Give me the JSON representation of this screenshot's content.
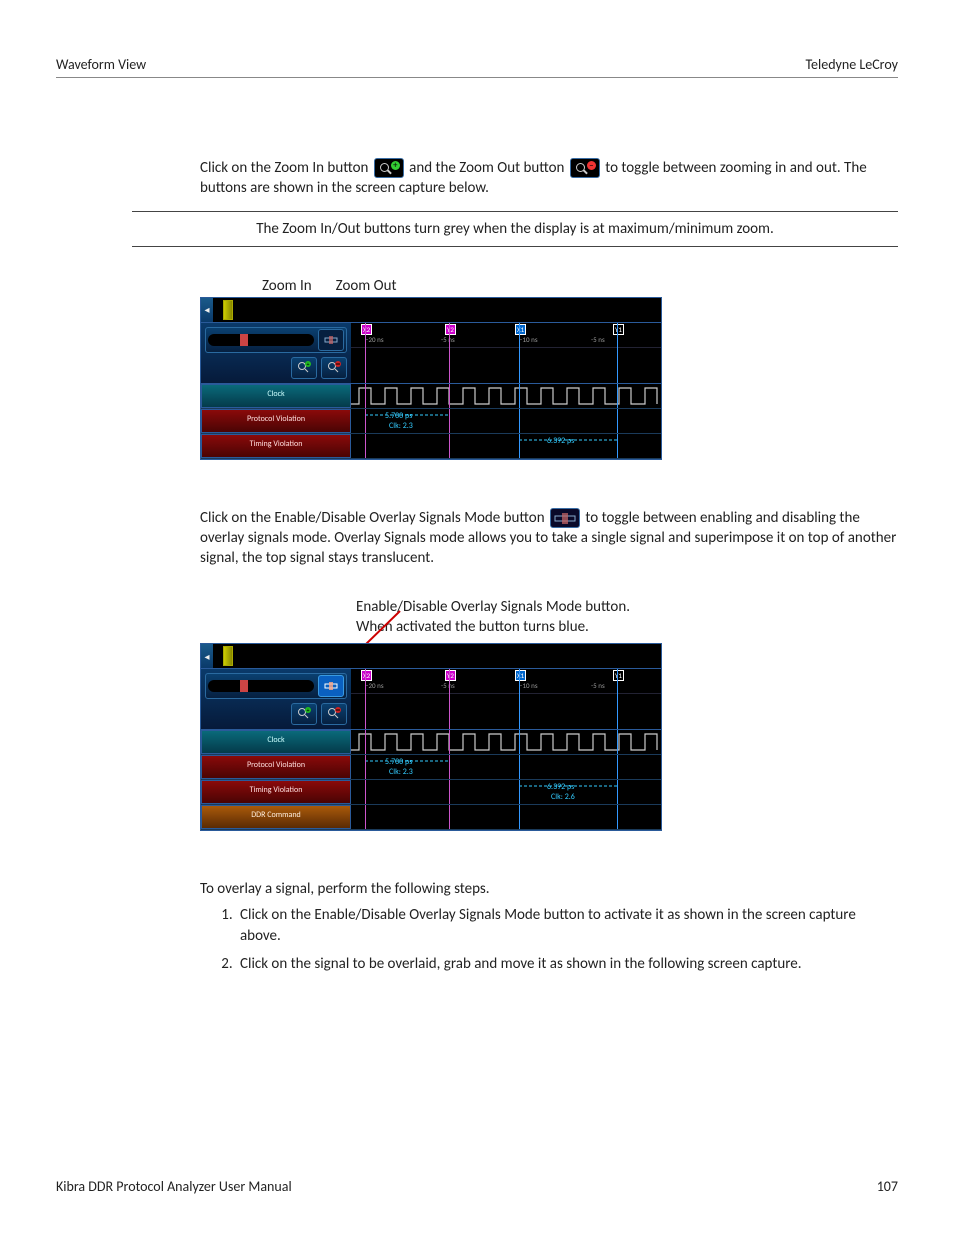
{
  "header": {
    "left": "Waveform View",
    "right": "Teledyne LeCroy"
  },
  "para1_a": "Click on the Zoom In button ",
  "para1_b": " and the Zoom Out button ",
  "para1_c": " to toggle between zooming in and out. The buttons are shown in the screen capture below.",
  "note1": "The Zoom In/Out buttons turn grey when the display is at maximum/minimum zoom.",
  "callout_zoom_in": "Zoom In",
  "callout_zoom_out": "Zoom Out",
  "shot1": {
    "markers": {
      "x2": "X2",
      "y2": "Y2",
      "x1": "X1",
      "y1": "Y1"
    },
    "ticks": {
      "t1": "−20 ns",
      "t2": "-5 ns",
      "t3": "−10 ns",
      "t4": "-5 ns"
    },
    "labels": {
      "clock": "Clock",
      "protocol": "Protocol Violation",
      "timing": "Timing Violation"
    },
    "meas": {
      "m1": "5.700 ps",
      "m1b": "Clk: 2.3",
      "m2": "6.392 ps"
    }
  },
  "para2_a": "Click on the Enable/Disable Overlay Signals Mode button ",
  "para2_b": " to toggle between enabling and disabling the overlay signals mode. Overlay Signals mode allows you to take a single signal and superimpose it on top of another signal, the top signal stays translucent.",
  "callout_overlay_l1": "Enable/Disable Overlay Signals Mode button.",
  "callout_overlay_l2": "When activated the button turns blue.",
  "shot2": {
    "markers": {
      "x2": "X2",
      "y2": "Y2",
      "x1": "X1",
      "y1": "Y1"
    },
    "ticks": {
      "t1": "−20 ns",
      "t2": "-5 ns",
      "t3": "−10 ns",
      "t4": "-5 ns"
    },
    "labels": {
      "clock": "Clock",
      "protocol": "Protocol Violation",
      "timing": "Timing Violation",
      "ddr": "DDR Command"
    },
    "meas": {
      "m1": "5.700 ps",
      "m1b": "Clk: 2.3",
      "m2": "6.392 ps",
      "m2b": "Clk: 2.6"
    }
  },
  "para3": "To overlay a signal, perform the following steps.",
  "steps": {
    "s1": "Click on the Enable/Disable Overlay Signals Mode button to activate it as shown in the screen capture above.",
    "s2": "Click on the signal to be overlaid, grab and move it as shown in the following screen capture."
  },
  "footer": {
    "left": "Kibra DDR Protocol Analyzer User Manual",
    "right": "107"
  }
}
